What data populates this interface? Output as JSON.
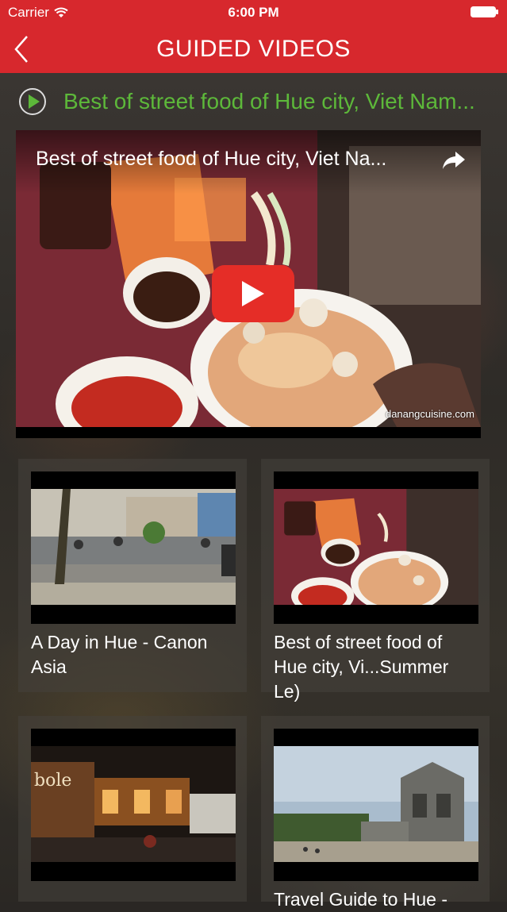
{
  "status_bar": {
    "carrier": "Carrier",
    "time": "6:00 PM"
  },
  "nav": {
    "title": "GUIDED VIDEOS"
  },
  "now_playing": {
    "title": "Best of street food of Hue city, Viet Nam..."
  },
  "player": {
    "title": "Best of street food of Hue city, Viet Na...",
    "watermark": "danangcuisine.com"
  },
  "videos": [
    {
      "caption": "A Day in Hue - Canon Asia",
      "thumbnail": "street-scene"
    },
    {
      "caption": "Best of street food of Hue city, Vi...Summer Le)",
      "thumbnail": "food-bowl"
    },
    {
      "caption": "",
      "thumbnail": "night-street"
    },
    {
      "caption": "Travel Guide to Hue -",
      "thumbnail": "tomb-monument"
    }
  ],
  "colors": {
    "header_red": "#d7282d",
    "accent_green": "#5db83a",
    "youtube_red": "#e52d27"
  }
}
